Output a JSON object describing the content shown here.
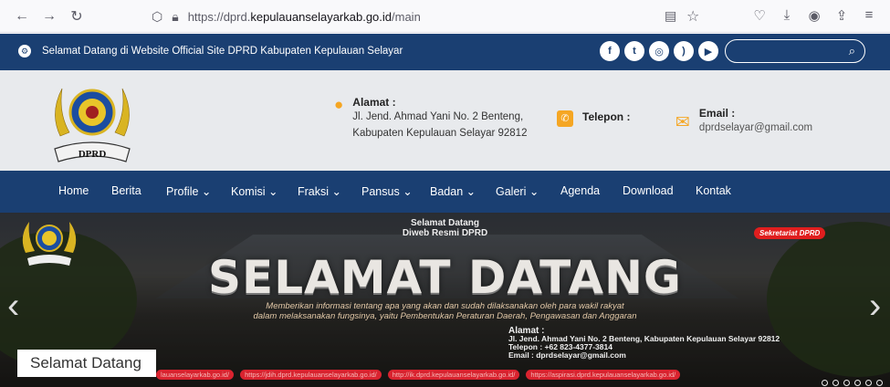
{
  "browser": {
    "url_prefix": "https://dprd.",
    "url_host": "kepulauanselayarkab.go.id",
    "url_path": "/main"
  },
  "topbar": {
    "welcome": "Selamat Datang di Website Official Site DPRD Kabupaten Kepulauan Selayar",
    "search_placeholder": "",
    "socials": [
      "facebook-icon",
      "twitter-icon",
      "instagram-icon",
      "rss-icon",
      "youtube-icon"
    ]
  },
  "header": {
    "address_title": "Alamat :",
    "address_line1": "Jl. Jend. Ahmad Yani No. 2 Benteng,",
    "address_line2": "Kabupaten Kepulauan Selayar 92812",
    "phone_title": "Telepon :",
    "email_title": "Email :",
    "email_value": "dprdselayar@gmail.com",
    "logo_text": "DPRD"
  },
  "nav": {
    "items": [
      "Home",
      "Berita",
      "Profile",
      "Komisi",
      "Fraksi",
      "Pansus",
      "Badan",
      "Galeri",
      "Agenda",
      "Download",
      "Kontak"
    ]
  },
  "hero": {
    "sub_line1": "Selamat Datang",
    "sub_line2": "Diweb Resmi DPRD",
    "title": "SELAMAT DATANG",
    "tagline1": "Memberikan informasi tentang apa yang akan dan sudah dilaksanakan oleh para wakil rakyat",
    "tagline2": "dalam melaksanakan fungsinya, yaitu Pembentukan Peraturan Daerah, Pengawasan dan Anggaran",
    "badge": "Sekretariat DPRD",
    "addr_title": "Alamat :",
    "addr_line1": "Jl. Jend. Ahmad Yani No. 2 Benteng, Kabupaten Kepulauan Selayar 92812",
    "addr_line2": "Telepon : +62 823-4377-3814",
    "addr_line3": "Email : dprdselayar@gmail.com",
    "caption": "Selamat Datang",
    "links": [
      "lauanselayarkab.go.id/",
      "https://jdih.dprd.kepulauanselayarkab.go.id/",
      "http://ik.dprd.kepulauanselayarkab.go.id/",
      "https://aspirasi.dprd.kepulauanselayarkab.go.id/"
    ]
  },
  "colors": {
    "brand": "#1a3f72",
    "accent": "#f5a623",
    "badge": "#e01e1e"
  }
}
